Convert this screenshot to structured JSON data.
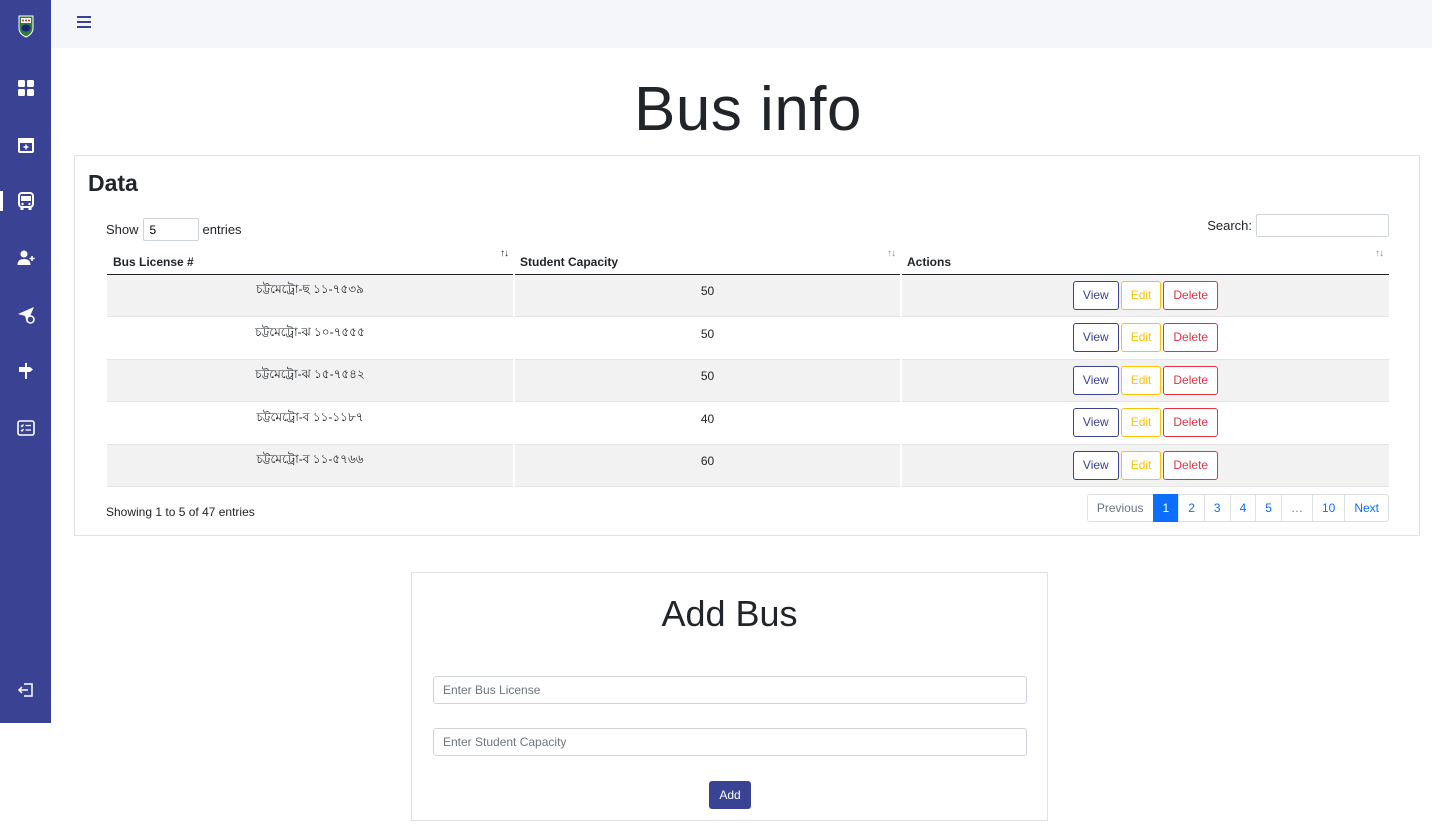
{
  "sidebar": {
    "items": [
      {
        "name": "dashboard-icon"
      },
      {
        "name": "calendar-add-icon"
      },
      {
        "name": "bus-icon",
        "active": true
      },
      {
        "name": "add-user-icon"
      },
      {
        "name": "send-icon"
      },
      {
        "name": "signpost-icon"
      },
      {
        "name": "list-card-icon"
      }
    ],
    "logout": "logout-icon"
  },
  "page": {
    "title": "Bus info"
  },
  "table_card": {
    "title": "Data",
    "length": {
      "prefix": "Show",
      "value": "5",
      "suffix": "entries"
    },
    "search_label": "Search:",
    "columns": [
      "Bus License #",
      "Student Capacity",
      "Actions"
    ],
    "rows": [
      {
        "license": "চট্টমেট্রো-ছ ১১-৭৫৩৯",
        "capacity": "50"
      },
      {
        "license": "চট্টমেট্রো-ঝ ১০-৭৫৫৫",
        "capacity": "50"
      },
      {
        "license": "চট্টমেট্রো-ঝ ১৫-৭৫৪২",
        "capacity": "50"
      },
      {
        "license": "চট্টমেট্রো-ব ১১-১১৮৭",
        "capacity": "40"
      },
      {
        "license": "চট্টমেট্রো-ব ১১-৫৭৬৬",
        "capacity": "60"
      }
    ],
    "actions": {
      "view": "View",
      "edit": "Edit",
      "delete": "Delete"
    },
    "info": "Showing 1 to 5 of 47 entries",
    "pagination": {
      "previous": "Previous",
      "pages": [
        "1",
        "2",
        "3",
        "4",
        "5",
        "…",
        "10"
      ],
      "active": "1",
      "next": "Next"
    }
  },
  "add_form": {
    "title": "Add Bus",
    "license_placeholder": "Enter Bus License",
    "capacity_placeholder": "Enter Student Capacity",
    "submit": "Add"
  },
  "colors": {
    "primary": "#3a4294",
    "accent": "#0d6efd",
    "warning": "#ffc107",
    "danger": "#dc3545"
  }
}
